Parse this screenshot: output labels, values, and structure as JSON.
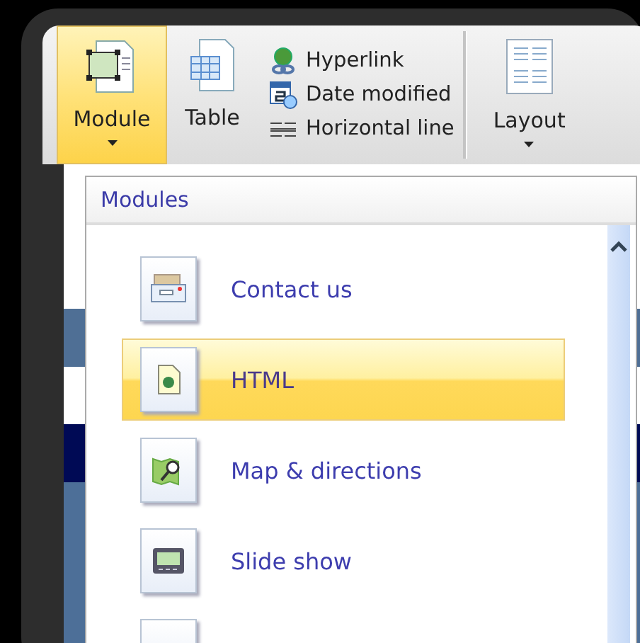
{
  "ribbon": {
    "large_buttons": [
      {
        "label": "Module",
        "selected": true,
        "dropdown": true
      },
      {
        "label": "Table",
        "selected": false,
        "dropdown": false
      }
    ],
    "small_buttons": [
      {
        "label": "Hyperlink"
      },
      {
        "label": "Date modified"
      },
      {
        "label": "Horizontal line"
      }
    ],
    "layout_button": {
      "label": "Layout",
      "dropdown": true
    }
  },
  "dropdown": {
    "title": "Modules",
    "items": [
      {
        "label": "Contact us",
        "selected": false
      },
      {
        "label": "HTML",
        "selected": true
      },
      {
        "label": "Map & directions",
        "selected": false
      },
      {
        "label": "Slide show",
        "selected": false
      },
      {
        "selected": false
      }
    ]
  }
}
